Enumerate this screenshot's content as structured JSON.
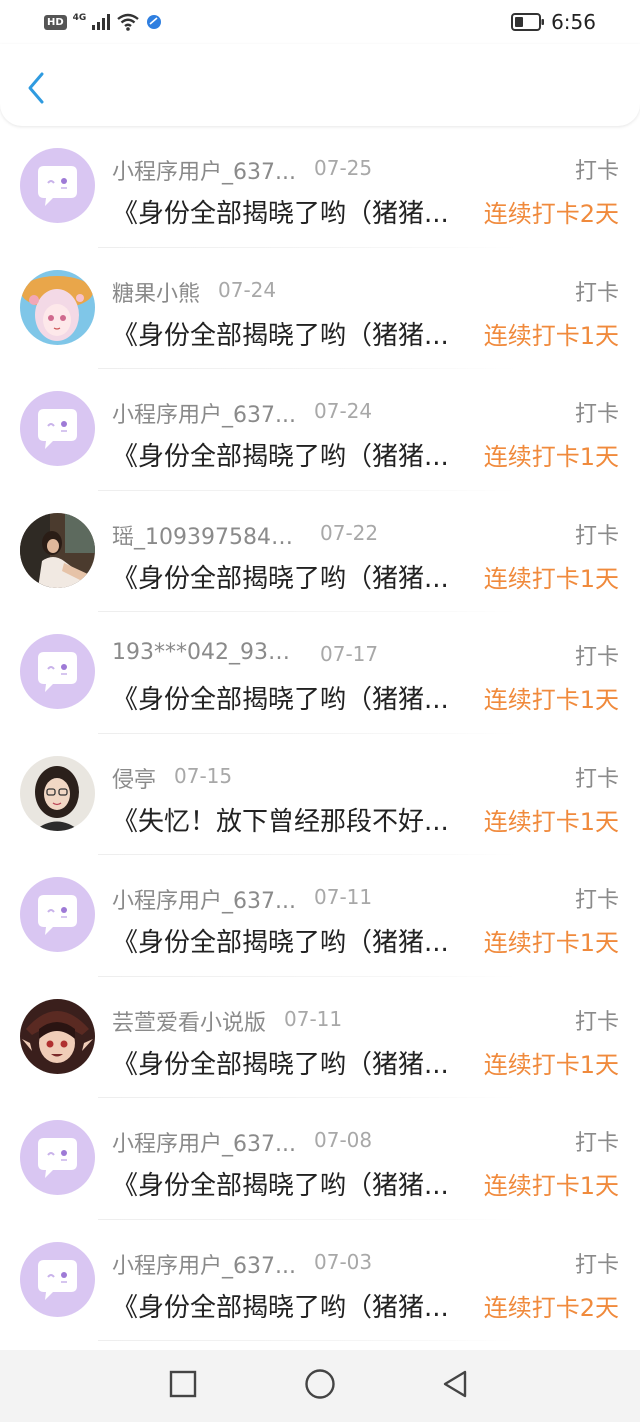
{
  "status_bar": {
    "hd": "HD",
    "network": "4G",
    "time": "6:56",
    "icons": [
      "signal-icon",
      "wifi-icon",
      "app-notification-icon",
      "battery-icon"
    ]
  },
  "header": {
    "back_icon": "chevron-left-icon",
    "accent_color": "#2f9be0"
  },
  "colors": {
    "streak": "#f08a3c",
    "meta_text": "#8a8a8a",
    "title_text": "#222222",
    "default_avatar_bg": "#d9c6f2"
  },
  "records": [
    {
      "name": "小程序用户_637...",
      "date": "07-25",
      "type": "打卡",
      "title": "《身份全部揭晓了哟（猪猪...",
      "streak": "连续打卡2天",
      "avatar": "default"
    },
    {
      "name": "糖果小熊",
      "date": "07-24",
      "type": "打卡",
      "title": "《身份全部揭晓了哟（猪猪...",
      "streak": "连续打卡1天",
      "avatar": "anime-girl"
    },
    {
      "name": "小程序用户_637...",
      "date": "07-24",
      "type": "打卡",
      "title": "《身份全部揭晓了哟（猪猪...",
      "streak": "连续打卡1天",
      "avatar": "default"
    },
    {
      "name": "瑶_1093975848...",
      "date": "07-22",
      "type": "打卡",
      "title": "《身份全部揭晓了哟（猪猪...",
      "streak": "连续打卡1天",
      "avatar": "photo"
    },
    {
      "name": "193***042_930...",
      "date": "07-17",
      "type": "打卡",
      "title": "《身份全部揭晓了哟（猪猪...",
      "streak": "连续打卡1天",
      "avatar": "default"
    },
    {
      "name": "侵亭",
      "date": "07-15",
      "type": "打卡",
      "title": "《失忆！放下曾经那段不好...",
      "streak": "连续打卡1天",
      "avatar": "portrait"
    },
    {
      "name": "小程序用户_637...",
      "date": "07-11",
      "type": "打卡",
      "title": "《身份全部揭晓了哟（猪猪...",
      "streak": "连续打卡1天",
      "avatar": "default"
    },
    {
      "name": "芸萱爱看小说版",
      "date": "07-11",
      "type": "打卡",
      "title": "《身份全部揭晓了哟（猪猪...",
      "streak": "连续打卡1天",
      "avatar": "anime-dark"
    },
    {
      "name": "小程序用户_637...",
      "date": "07-08",
      "type": "打卡",
      "title": "《身份全部揭晓了哟（猪猪...",
      "streak": "连续打卡1天",
      "avatar": "default"
    },
    {
      "name": "小程序用户_637...",
      "date": "07-03",
      "type": "打卡",
      "title": "《身份全部揭晓了哟（猪猪...",
      "streak": "连续打卡2天",
      "avatar": "default"
    }
  ],
  "nav_bar": {
    "icons": [
      "recent-apps-icon",
      "home-icon",
      "back-triangle-icon"
    ]
  }
}
